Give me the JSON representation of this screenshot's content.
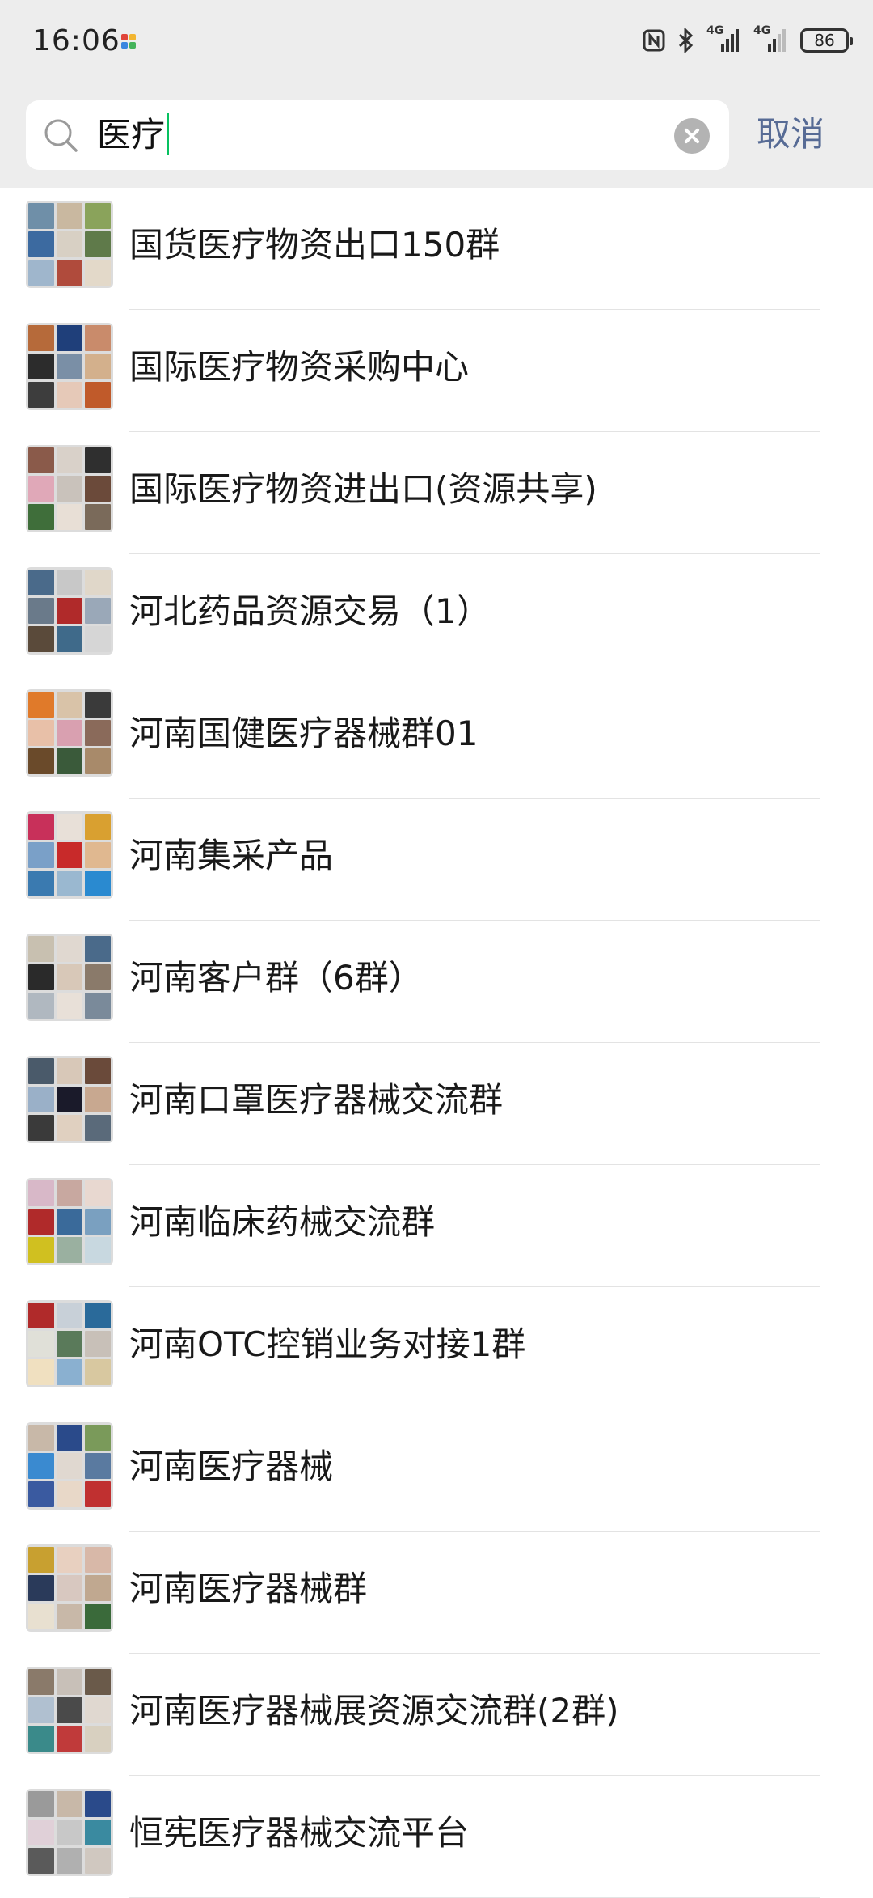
{
  "status_bar": {
    "time": "16:06",
    "network_1": "4G",
    "network_2": "4G",
    "battery": "86",
    "icons": [
      "nfc-icon",
      "bluetooth-icon",
      "signal-icon",
      "signal-icon",
      "battery-icon"
    ]
  },
  "search": {
    "query": "医疗",
    "cancel_label": "取消",
    "accent_color": "#07c160",
    "link_color": "#576b95"
  },
  "results": [
    {
      "title": "国货医疗物资出口150群",
      "colors": [
        "#6f8fa8",
        "#c9b8a0",
        "#8aa35b",
        "#3c6aa0",
        "#d8d0c4",
        "#5f7a4a",
        "#9fb6cc",
        "#b04b3c",
        "#e3d9c9"
      ]
    },
    {
      "title": "国际医疗物资采购中心",
      "colors": [
        "#b66a3a",
        "#1f3f7a",
        "#c98b6b",
        "#2c2c2c",
        "#7a8fa6",
        "#d3b08c",
        "#3d3d3d",
        "#e6c9b8",
        "#c05a2a"
      ]
    },
    {
      "title": "国际医疗物资进出口(资源共享)",
      "colors": [
        "#8a5a4a",
        "#d9d1c9",
        "#2f2f2f",
        "#e0a8b8",
        "#c9c2bb",
        "#6b4a3a",
        "#3f6e3a",
        "#e8dfd6",
        "#7a6a5a"
      ]
    },
    {
      "title": "河北药品资源交易（1）",
      "colors": [
        "#4a6a8a",
        "#c8c8c8",
        "#e0d7c9",
        "#6a7a8a",
        "#b02a2a",
        "#9aa8b8",
        "#5a4a3a",
        "#3f6a8a",
        "#d6d6d6"
      ]
    },
    {
      "title": "河南国健医疗器械群01",
      "colors": [
        "#e07a2a",
        "#d9c3a8",
        "#3a3a3a",
        "#e8c0a8",
        "#d9a0b0",
        "#8a6a5a",
        "#6a4a2a",
        "#3a5a3a",
        "#a88a6a"
      ]
    },
    {
      "title": "河南集采产品",
      "colors": [
        "#c8305a",
        "#e8e0d8",
        "#d9a030",
        "#7aa0c8",
        "#c82a2a",
        "#e0b890",
        "#3a7ab0",
        "#9ab8d0",
        "#2a8ad0"
      ]
    },
    {
      "title": "河南客户群（6群）",
      "colors": [
        "#c8c0b0",
        "#e0d8d0",
        "#4a6a8a",
        "#2a2a2a",
        "#d8c8b8",
        "#8a7a6a",
        "#b0b8c0",
        "#e8e0d8",
        "#7a8a9a"
      ]
    },
    {
      "title": "河南口罩医疗器械交流群",
      "colors": [
        "#4a5a6a",
        "#d8c8b8",
        "#6a4a3a",
        "#9ab0c8",
        "#1a1a2a",
        "#c8a890",
        "#3a3a3a",
        "#e0d0c0",
        "#5a6a7a"
      ]
    },
    {
      "title": "河南临床药械交流群",
      "colors": [
        "#d8b8c8",
        "#c8a8a0",
        "#e8d8d0",
        "#b02a2a",
        "#3a6a9a",
        "#7aa0c0",
        "#d0c020",
        "#9ab0a0",
        "#c8d8e0"
      ]
    },
    {
      "title": "河南OTC控销业务对接1群",
      "colors": [
        "#b02a2a",
        "#c8d0d8",
        "#2a6a9a",
        "#e0e0d8",
        "#5a7a5a",
        "#c8c0b8",
        "#f0e0c0",
        "#8ab0d0",
        "#d8c8a0"
      ]
    },
    {
      "title": "河南医疗器械",
      "colors": [
        "#c8b8a8",
        "#2a4a8a",
        "#7a9a5a",
        "#3a8ad0",
        "#e0d8d0",
        "#5a7aa0",
        "#3a5aa0",
        "#e8d8c8",
        "#c03030"
      ]
    },
    {
      "title": "河南医疗器械群",
      "colors": [
        "#c8a030",
        "#e8d0c0",
        "#d8b8a8",
        "#2a3a5a",
        "#d8c8c0",
        "#c0a890",
        "#e8e0d0",
        "#c8b8a8",
        "#3a6a3a"
      ]
    },
    {
      "title": "河南医疗器械展资源交流群(2群)",
      "colors": [
        "#8a7a6a",
        "#c8c0b8",
        "#6a5a4a",
        "#b0c0d0",
        "#4a4a4a",
        "#e0d8d0",
        "#3a8a8a",
        "#c03a3a",
        "#d8d0c0"
      ]
    },
    {
      "title": "恒宪医疗器械交流平台",
      "colors": [
        "#9a9a9a",
        "#c8b8a8",
        "#2a4a8a",
        "#e0d0d8",
        "#c8c8c8",
        "#3a8aa0",
        "#5a5a5a",
        "#b0b0b0",
        "#d0c8c0"
      ]
    }
  ]
}
